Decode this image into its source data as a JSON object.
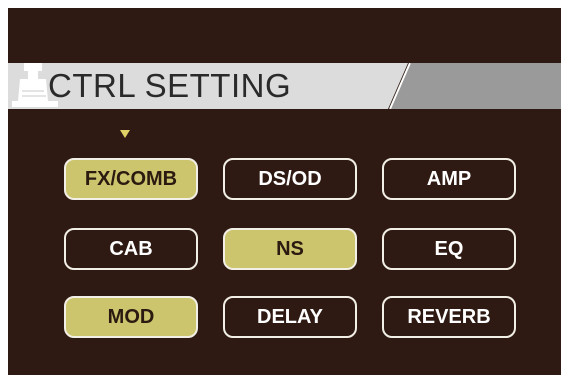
{
  "screen": {
    "title": "CTRL SETTING",
    "cursor_target": "FX/COMB",
    "colors": {
      "background": "#2e1a12",
      "active": "#cdc46e",
      "border": "#f2efe6",
      "title_bar": "#dcdcdc"
    }
  },
  "buttons": [
    {
      "label": "FX/COMB",
      "active": true
    },
    {
      "label": "DS/OD",
      "active": false
    },
    {
      "label": "AMP",
      "active": false
    },
    {
      "label": "CAB",
      "active": false
    },
    {
      "label": "NS",
      "active": true
    },
    {
      "label": "EQ",
      "active": false
    },
    {
      "label": "MOD",
      "active": true
    },
    {
      "label": "DELAY",
      "active": false
    },
    {
      "label": "REVERB",
      "active": false
    }
  ],
  "icons": {
    "header": "pedal-icon",
    "cursor": "cursor-triangle-icon"
  }
}
